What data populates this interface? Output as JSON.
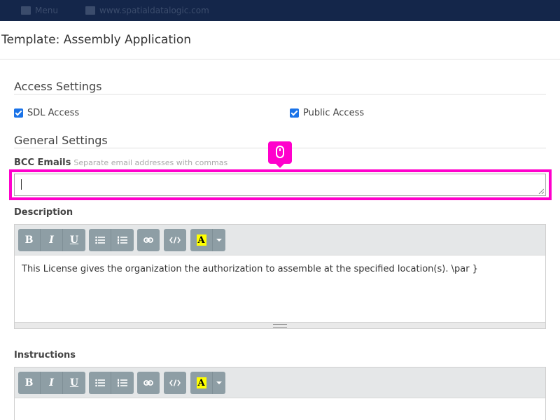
{
  "background": {
    "menu_label": "Menu",
    "site_label": "www.spatialdatalogic.com"
  },
  "modal": {
    "title": "Template: Assembly Application"
  },
  "access_settings": {
    "title": "Access Settings",
    "sdl_access": {
      "label": "SDL Access",
      "checked": true
    },
    "public_access": {
      "label": "Public Access",
      "checked": true
    }
  },
  "general_settings": {
    "title": "General Settings",
    "bcc": {
      "label": "BCC Emails",
      "hint": "Separate email addresses with commas",
      "value": ""
    },
    "description": {
      "label": "Description",
      "content": "This License gives the organization the authorization to assemble at the specified location(s). \\par }"
    },
    "instructions": {
      "label": "Instructions",
      "content": ""
    }
  },
  "toolbar": {
    "bold": "B",
    "italic": "I",
    "underline": "U",
    "highlight": "A"
  },
  "colors": {
    "highlight_border": "#ff00cc",
    "toolbar_button": "#8e9ea5",
    "checkbox": "#1a73e8"
  },
  "icons": [
    "book-icon",
    "graduation-cap-icon",
    "mouse-icon",
    "unordered-list-icon",
    "ordered-list-icon",
    "link-icon",
    "code-icon",
    "highlight-color-icon",
    "dropdown-caret-icon",
    "resize-grip-icon"
  ]
}
